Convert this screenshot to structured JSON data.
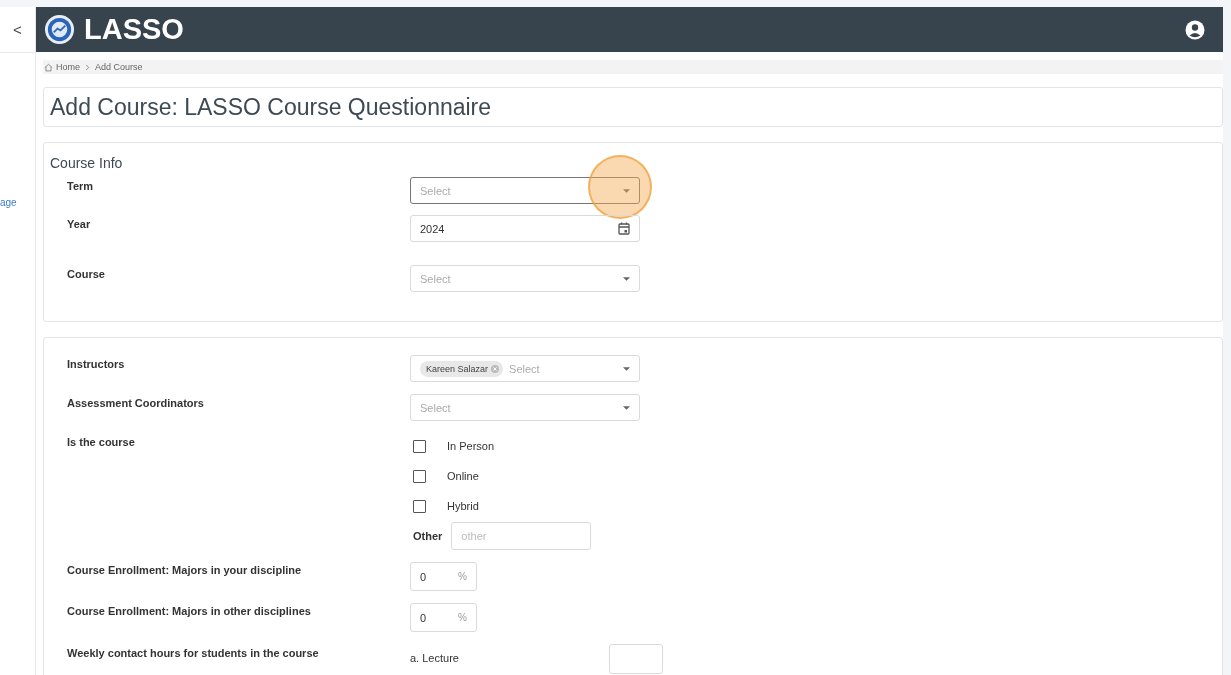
{
  "sidebar": {
    "collapse_glyph": "<",
    "link_fragment": "age"
  },
  "header": {
    "title": "LASSO"
  },
  "breadcrumb": [
    "Home",
    "Add Course"
  ],
  "page_title": "Add Course: LASSO Course Questionnaire",
  "course_info": {
    "heading": "Course Info",
    "fields": [
      {
        "label": "Term",
        "kind": "select",
        "placeholder": "Select",
        "focused": true
      },
      {
        "label": "Year",
        "kind": "date",
        "value": "2024",
        "focused": false
      },
      {
        "label": "Course",
        "kind": "select",
        "placeholder": "Select",
        "focused": false
      }
    ]
  },
  "details": {
    "rows": [
      {
        "kind": "select",
        "label": "Instructors",
        "chips": [
          "Kareen Salazar"
        ],
        "placeholder": "Select"
      },
      {
        "kind": "select",
        "label": "Assessment Coordinators",
        "placeholder": "Select"
      },
      {
        "kind": "checkboxes",
        "label": "Is the course",
        "options": [
          {
            "label": "In Person",
            "checked": false
          },
          {
            "label": "Online",
            "checked": false
          },
          {
            "label": "Hybrid",
            "checked": false
          }
        ],
        "other_label": "Other",
        "other_placeholder": "other"
      },
      {
        "kind": "percent",
        "label": "Course Enrollment: Majors in your discipline",
        "value": "0",
        "unit": "%"
      },
      {
        "kind": "percent",
        "label": "Course Enrollment: Majors in other disciplines",
        "value": "0",
        "unit": "%"
      },
      {
        "kind": "hours",
        "label": "Weekly contact hours for students in the course",
        "sub_label": "a. Lecture"
      }
    ]
  }
}
